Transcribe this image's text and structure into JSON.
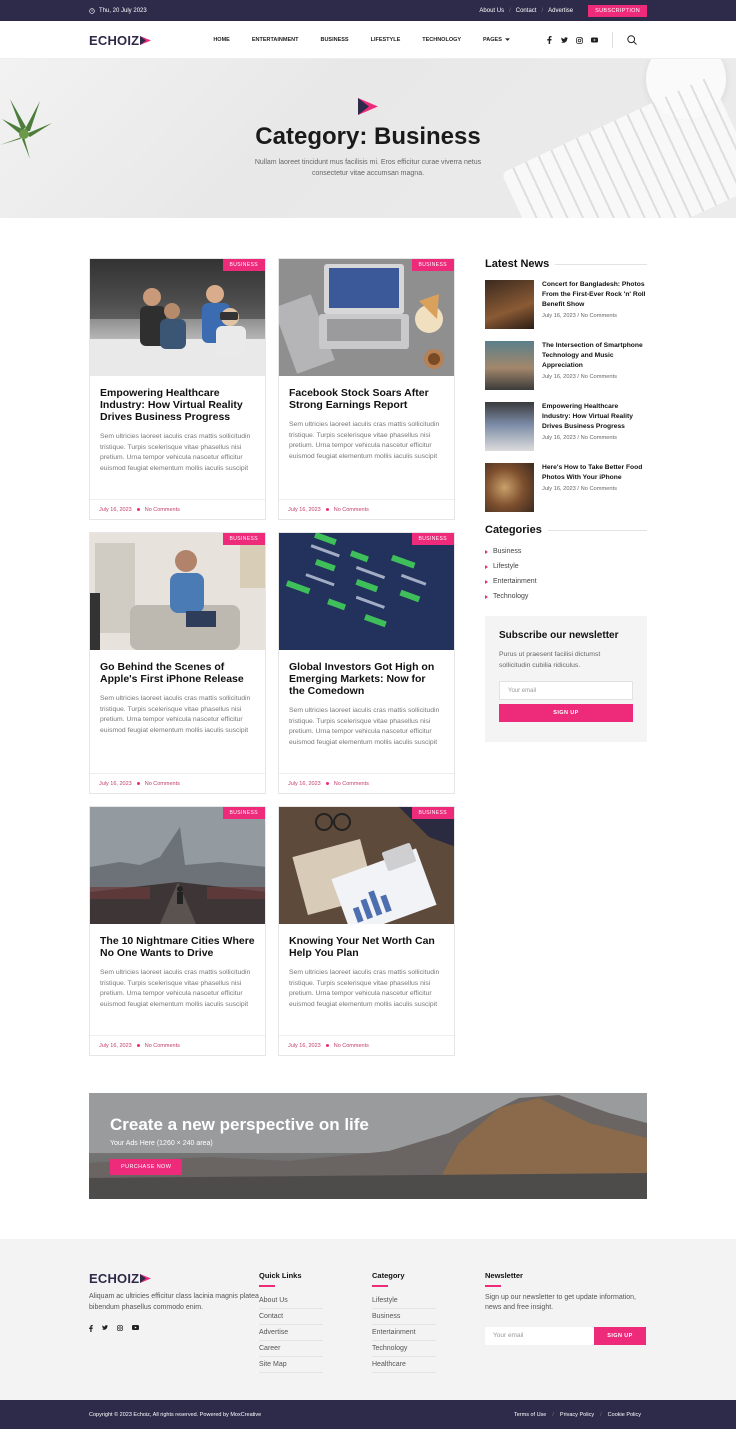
{
  "topbar": {
    "date": "Thu, 20 July 2023",
    "links": [
      "About Us",
      "Contact",
      "Advertise"
    ],
    "subscription": "SUBSCRIPTION"
  },
  "header": {
    "logo": "ECHOIZ",
    "nav": [
      "HOME",
      "ENTERTAINMENT",
      "BUSINESS",
      "LIFESTYLE",
      "TECHNOLOGY",
      "PAGES"
    ],
    "social_icons": [
      "facebook-icon",
      "twitter-icon",
      "instagram-icon",
      "youtube-icon"
    ]
  },
  "hero": {
    "title": "Category: Business",
    "description": "Nullam laoreet tincidunt mus facilisis mi. Eros efficitur curae viverra netus consectetur vitae accumsan magna."
  },
  "posts": [
    {
      "badge": "BUSINESS",
      "title": "Empowering Healthcare Industry: How Virtual Reality Drives Business Progress",
      "excerpt": "Sem ultricies laoreet iaculis cras mattis sollicitudin tristique. Turpis scelerisque vitae phasellus nisi pretium. Urna tempor vehicula nascetur efficitur euismod feugiat elementum mollis iaculis suscipit",
      "date": "July 16, 2023",
      "comments": "No Comments"
    },
    {
      "badge": "BUSINESS",
      "title": "Facebook Stock Soars After Strong Earnings Report",
      "excerpt": "Sem ultricies laoreet iaculis cras mattis sollicitudin tristique. Turpis scelerisque vitae phasellus nisi pretium. Urna tempor vehicula nascetur efficitur euismod feugiat elementum mollis iaculis suscipit",
      "date": "July 16, 2023",
      "comments": "No Comments"
    },
    {
      "badge": "BUSINESS",
      "title": "Go Behind the Scenes of Apple's First iPhone Release",
      "excerpt": "Sem ultricies laoreet iaculis cras mattis sollicitudin tristique. Turpis scelerisque vitae phasellus nisi pretium. Urna tempor vehicula nascetur efficitur euismod feugiat elementum mollis iaculis suscipit",
      "date": "July 16, 2023",
      "comments": "No Comments"
    },
    {
      "badge": "BUSINESS",
      "title": "Global Investors Got High on Emerging Markets: Now for the Comedown",
      "excerpt": "Sem ultricies laoreet iaculis cras mattis sollicitudin tristique. Turpis scelerisque vitae phasellus nisi pretium. Urna tempor vehicula nascetur efficitur euismod feugiat elementum mollis iaculis suscipit",
      "date": "July 16, 2023",
      "comments": "No Comments"
    },
    {
      "badge": "BUSINESS",
      "title": "The 10 Nightmare Cities Where No One Wants to Drive",
      "excerpt": "Sem ultricies laoreet iaculis cras mattis sollicitudin tristique. Turpis scelerisque vitae phasellus nisi pretium. Urna tempor vehicula nascetur efficitur euismod feugiat elementum mollis iaculis suscipit",
      "date": "July 16, 2023",
      "comments": "No Comments"
    },
    {
      "badge": "BUSINESS",
      "title": "Knowing Your Net Worth Can Help You Plan",
      "excerpt": "Sem ultricies laoreet iaculis cras mattis sollicitudin tristique. Turpis scelerisque vitae phasellus nisi pretium. Urna tempor vehicula nascetur efficitur euismod feugiat elementum mollis iaculis suscipit",
      "date": "July 16, 2023",
      "comments": "No Comments"
    }
  ],
  "sidebar": {
    "latest_title": "Latest News",
    "latest": [
      {
        "title": "Concert for Bangladesh: Photos From the First-Ever Rock 'n' Roll Benefit Show",
        "date": "July 16, 2023",
        "comments": "No Comments"
      },
      {
        "title": "The Intersection of Smartphone Technology and Music Appreciation",
        "date": "July 16, 2023",
        "comments": "No Comments"
      },
      {
        "title": "Empowering Healthcare Industry: How Virtual Reality Drives Business Progress",
        "date": "July 16, 2023",
        "comments": "No Comments"
      },
      {
        "title": "Here's How to Take Better Food Photos With Your iPhone",
        "date": "July 16, 2023",
        "comments": "No Comments"
      }
    ],
    "categories_title": "Categories",
    "categories": [
      "Business",
      "Lifestyle",
      "Entertainment",
      "Technology"
    ],
    "newsletter": {
      "title": "Subscribe our newsletter",
      "text": "Purus ut praesent facilisi dictumst sollicitudin cubilia ridiculus.",
      "placeholder": "Your email",
      "button": "SIGN UP"
    }
  },
  "banner": {
    "title": "Create a new perspective on life",
    "subtitle": "Your Ads Here (1260 × 240 area)",
    "button": "PURCHASE NOW"
  },
  "footer": {
    "logo": "ECHOIZ",
    "about": "Aliquam ac ultricies efficitur class lacinia magnis platea bibendum phasellus commodo enim.",
    "quick_title": "Quick Links",
    "quick": [
      "About Us",
      "Contact",
      "Advertise",
      "Career",
      "Site Map"
    ],
    "cat_title": "Category",
    "cats": [
      "Lifestyle",
      "Business",
      "Entertainment",
      "Technology",
      "Healthcare"
    ],
    "news_title": "Newsletter",
    "news_text": "Sign up our newsletter to get update information, news and free insight.",
    "news_placeholder": "Your email",
    "news_button": "SIGN UP",
    "copyright": "Copyright © 2023 Echoiz, All rights reserved. Powered by MoxCreative",
    "legal": [
      "Terms of Use",
      "Privacy Policy",
      "Cookie Policy"
    ]
  },
  "colors": {
    "accent": "#ee2a7b",
    "dark": "#2d2a4a"
  }
}
